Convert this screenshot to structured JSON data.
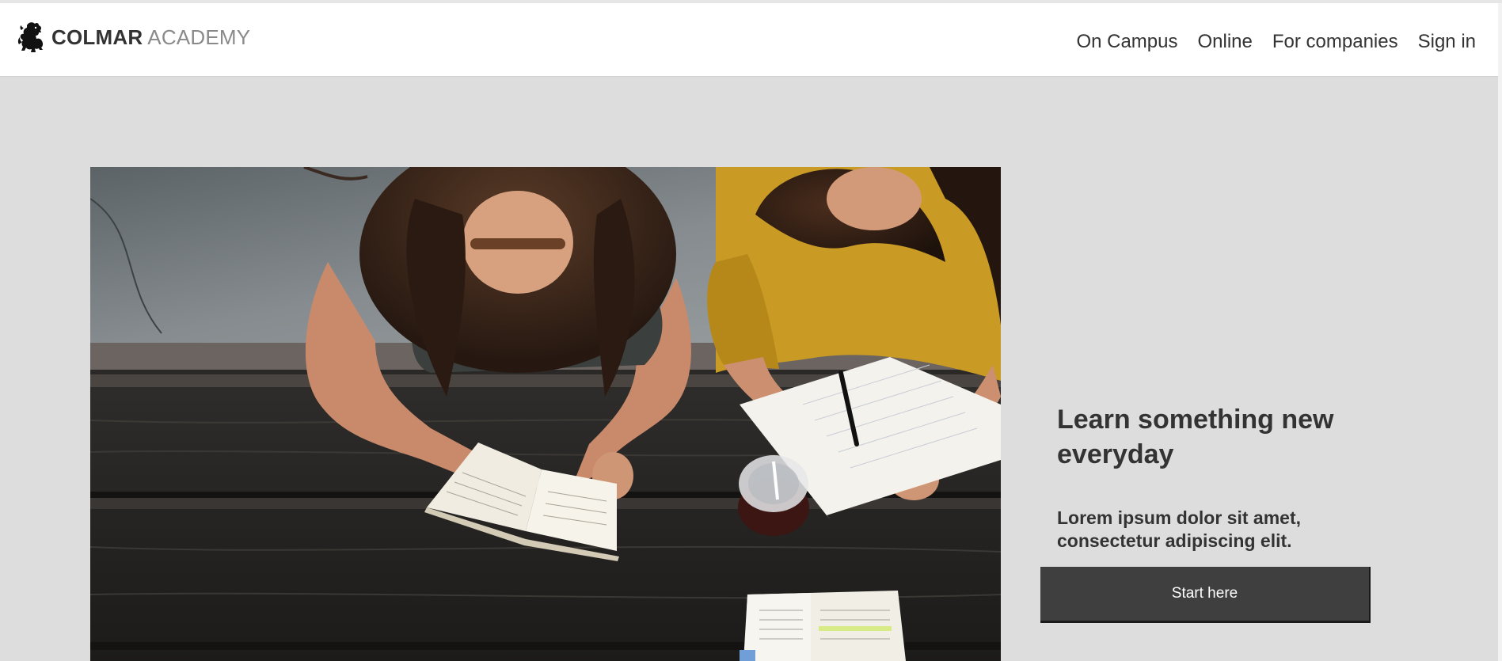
{
  "brand": {
    "name_bold": "COLMAR",
    "name_light": "ACADEMY",
    "icon": "lion-rampant-icon"
  },
  "nav": {
    "items": [
      {
        "label": "On Campus"
      },
      {
        "label": "Online"
      },
      {
        "label": "For companies"
      },
      {
        "label": "Sign in"
      }
    ]
  },
  "hero": {
    "title": "Learn something new everyday",
    "subtitle": "Lorem ipsum dolor sit amet, consectetur adipiscing elit.",
    "cta_label": "Start here",
    "image": "two-students-studying-at-wooden-table-photo"
  },
  "colors": {
    "page_background": "#dddddd",
    "header_background": "#ffffff",
    "text": "#333333",
    "brand_light": "#8a8a8a",
    "button_background": "#3f3f3f",
    "button_text": "#ffffff"
  }
}
